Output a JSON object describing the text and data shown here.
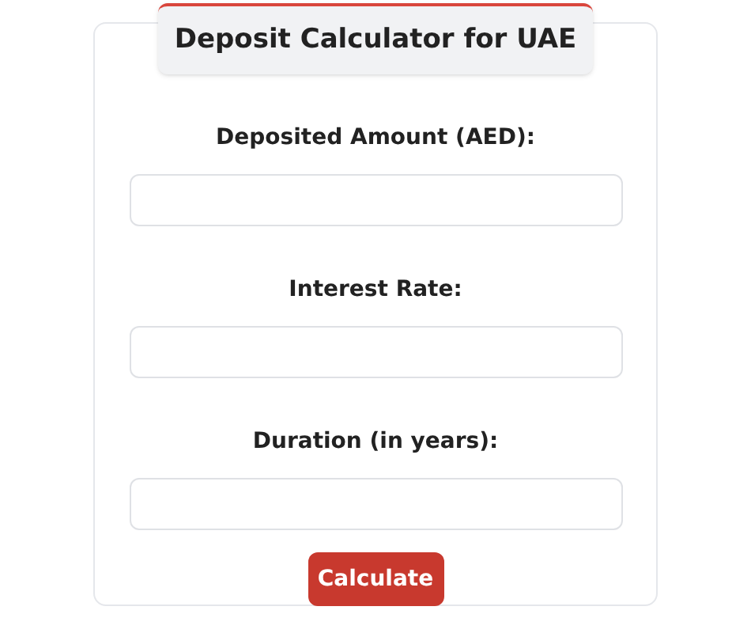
{
  "title": "Deposit Calculator for UAE",
  "fields": [
    {
      "label": "Deposited Amount (AED):"
    },
    {
      "label": "Interest Rate:"
    },
    {
      "label": "Duration (in years):"
    }
  ],
  "button": "Calculate"
}
